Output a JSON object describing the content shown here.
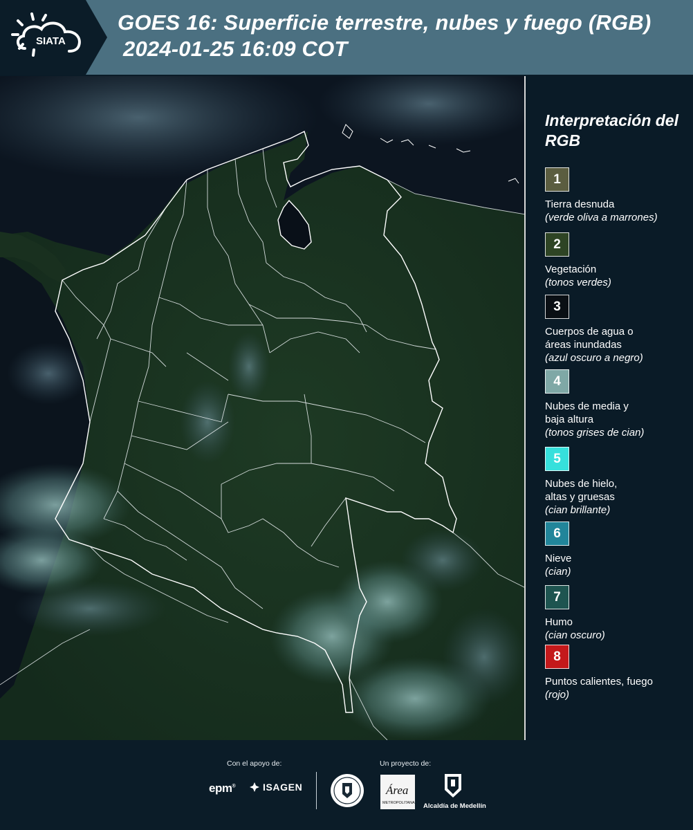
{
  "header": {
    "logo_text": "SIATA",
    "title_line1": "GOES 16: Superficie terrestre, nubes y fuego (RGB)",
    "title_line2": "2024-01-25 16:09 COT"
  },
  "legend": {
    "title": "Interpretación del RGB",
    "items": [
      {
        "number": "1",
        "name": "Tierra desnuda",
        "desc": "(verde oliva a marrones)",
        "color": "#5b5d40"
      },
      {
        "number": "2",
        "name": "Vegetación",
        "desc": "(tonos verdes)",
        "color": "#2e4424"
      },
      {
        "number": "3",
        "name": "Cuerpos de agua o\náreas inundadas",
        "desc": "(azul oscuro a negro)",
        "color": "#0a0f14"
      },
      {
        "number": "4",
        "name": "Nubes de media y\nbaja altura",
        "desc": "(tonos grises de cian)",
        "color": "#7fa8a6"
      },
      {
        "number": "5",
        "name": "Nubes de hielo,\naltas y gruesas",
        "desc": "(cian brillante)",
        "color": "#36e0dc"
      },
      {
        "number": "6",
        "name": "Nieve",
        "desc": "(cian)",
        "color": "#21859a"
      },
      {
        "number": "7",
        "name": "Humo",
        "desc": "(cian oscuro)",
        "color": "#1e5450"
      },
      {
        "number": "8",
        "name": "Puntos calientes, fuego",
        "desc": "(rojo)",
        "color": "#c4191b"
      }
    ]
  },
  "footer": {
    "support_label": "Con el apoyo de:",
    "project_label": "Un proyecto de:",
    "sponsors": [
      "epm",
      "ISAGEN"
    ],
    "area_logo_text": "Área",
    "area_logo_subtext": "METROPOLITANA",
    "alcaldia": "Alcaldía de Medellín"
  }
}
